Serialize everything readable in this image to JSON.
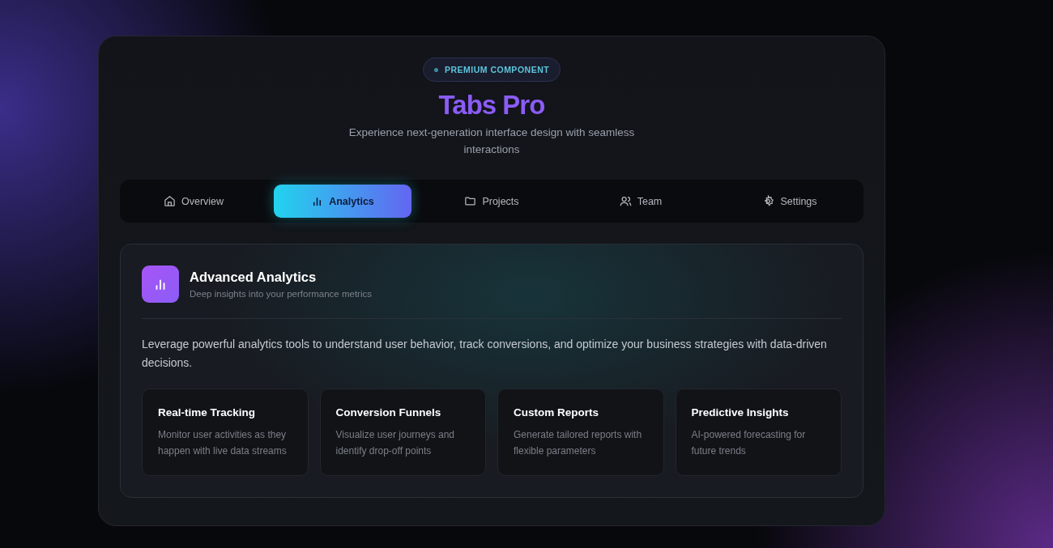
{
  "badge": "PREMIUM COMPONENT",
  "title": "Tabs Pro",
  "subtitle": "Experience next-generation interface design with seamless interactions",
  "tabs": [
    {
      "label": "Overview",
      "selected": false
    },
    {
      "label": "Analytics",
      "selected": true
    },
    {
      "label": "Projects",
      "selected": false
    },
    {
      "label": "Team",
      "selected": false
    },
    {
      "label": "Settings",
      "selected": false
    }
  ],
  "panel": {
    "title": "Advanced Analytics",
    "subtitle": "Deep insights into your performance metrics",
    "description": "Leverage powerful analytics tools to understand user behavior, track conversions, and optimize your business strategies with data-driven decisions.",
    "features": [
      {
        "title": "Real-time Tracking",
        "text": "Monitor user activities as they happen with live data streams"
      },
      {
        "title": "Conversion Funnels",
        "text": "Visualize user journeys and identify drop-off points"
      },
      {
        "title": "Custom Reports",
        "text": "Generate tailored reports with flexible parameters"
      },
      {
        "title": "Predictive Insights",
        "text": "AI-powered forecasting for future trends"
      }
    ]
  }
}
